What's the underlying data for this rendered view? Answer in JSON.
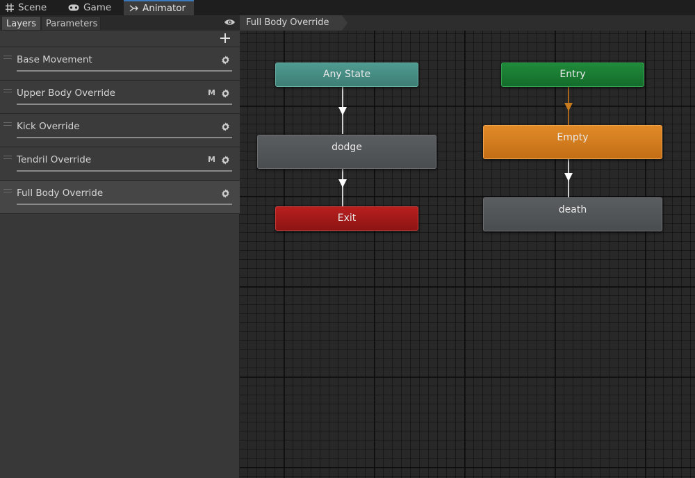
{
  "window_tabs": [
    {
      "label": "Scene",
      "icon": "grid-icon"
    },
    {
      "label": "Game",
      "icon": "gamepad-icon"
    },
    {
      "label": "Animator",
      "icon": "animator-icon",
      "active": true
    }
  ],
  "left_panel": {
    "tabs": [
      {
        "label": "Layers",
        "active": true
      },
      {
        "label": "Parameters"
      }
    ],
    "add_icon": "plus-icon",
    "visibility_icon": "eye-icon",
    "layers": [
      {
        "name": "Base Movement",
        "badge": ""
      },
      {
        "name": "Upper Body Override",
        "badge": "M"
      },
      {
        "name": "Kick Override",
        "badge": ""
      },
      {
        "name": "Tendril Override",
        "badge": "M"
      },
      {
        "name": "Full Body Override",
        "badge": "",
        "selected": true
      }
    ]
  },
  "graph": {
    "breadcrumb": "Full Body Override",
    "nodes": {
      "any_state": "Any State",
      "entry": "Entry",
      "dodge": "dodge",
      "empty": "Empty",
      "exit": "Exit",
      "death": "death"
    },
    "colors": {
      "any_state": "#4f9b91",
      "entry": "#1f8a3a",
      "exit": "#b81f1f",
      "state": "#55585b",
      "default_state": "#e08a28",
      "default_transition": "#c87a1e",
      "transition": "#ffffff",
      "accent": "#3a79bb"
    }
  }
}
